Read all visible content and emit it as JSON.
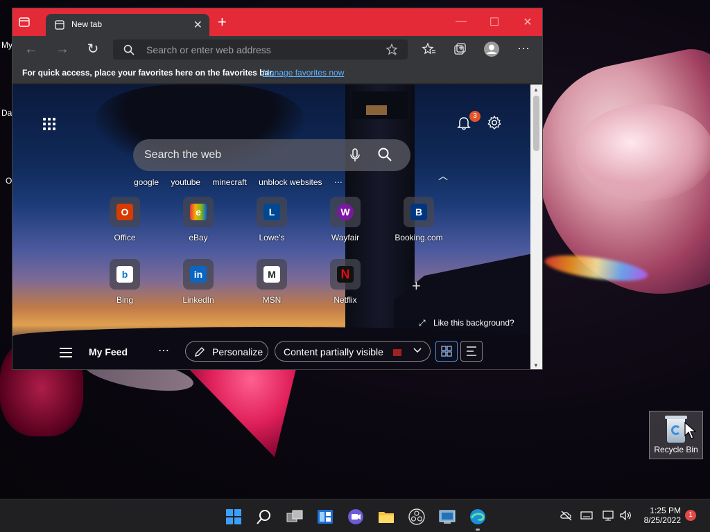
{
  "desktop": {
    "left_labels": [
      "My",
      "Da",
      "O"
    ],
    "recycle_bin_label": "Recycle Bin"
  },
  "browser": {
    "tab_title": "New tab",
    "address_placeholder": "Search or enter web address",
    "favorites_message": "For quick access, place your favorites here on the favorites bar.",
    "favorites_link": "Manage favorites now",
    "accent_color": "#e52a37"
  },
  "newtab": {
    "notification_count": "3",
    "search_placeholder": "Search the web",
    "quick_searches": [
      "google",
      "youtube",
      "minecraft",
      "unblock websites"
    ],
    "quick_links": [
      {
        "label": "Office",
        "glyph": "O",
        "color": "#d83b01"
      },
      {
        "label": "eBay",
        "glyph": "e",
        "color": "#e53238"
      },
      {
        "label": "Lowe's",
        "glyph": "L",
        "color": "#004990"
      },
      {
        "label": "Wayfair",
        "glyph": "W",
        "color": "#7b189f"
      },
      {
        "label": "Booking.com",
        "glyph": "B",
        "color": "#003580"
      },
      {
        "label": "Bing",
        "glyph": "b",
        "color": "#0078d4"
      },
      {
        "label": "LinkedIn",
        "glyph": "in",
        "color": "#0a66c2"
      },
      {
        "label": "MSN",
        "glyph": "M",
        "color": "#222222"
      },
      {
        "label": "Netflix",
        "glyph": "N",
        "color": "#e50914"
      }
    ],
    "like_background": "Like this background?",
    "feed_title": "My Feed",
    "personalize": "Personalize",
    "visibility": "Content partially visible"
  },
  "taskbar": {
    "time": "1:25 PM",
    "date": "8/25/2022",
    "notification_count": "1"
  }
}
